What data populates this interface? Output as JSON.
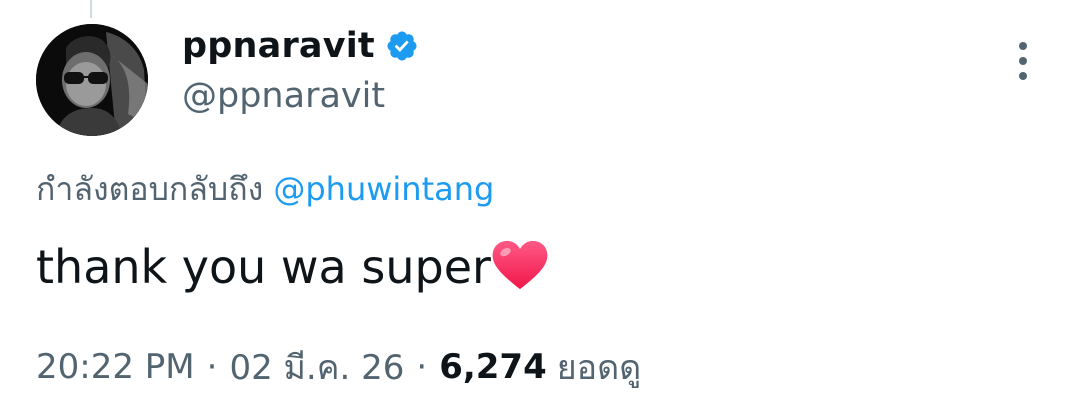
{
  "author": {
    "display_name": "ppnaravit",
    "handle": "@ppnaravit",
    "verified": true,
    "verified_color": "#1d9bf0",
    "avatar_icon": "avatar-photo"
  },
  "reply": {
    "prefix": "กำลังตอบกลับถึง",
    "mention": "@phuwintang"
  },
  "tweet": {
    "text": "thank you wa super",
    "emoji_icon": "red-heart-emoji"
  },
  "meta": {
    "time": "20:22 PM",
    "separator": "·",
    "date": "02 มี.ค. 26",
    "views_count": "6,274",
    "views_label": "ยอดดู"
  },
  "colors": {
    "primary_text": "#0f1419",
    "secondary_text": "#536471",
    "link": "#1d9bf0",
    "heart": "#f91880"
  }
}
